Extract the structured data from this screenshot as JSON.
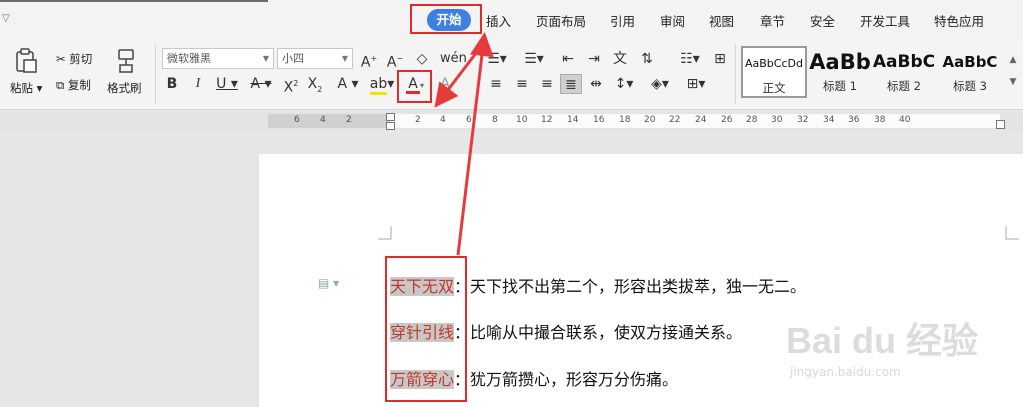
{
  "menu": {
    "tabs": [
      "插入",
      "页面布局",
      "引用",
      "审阅",
      "视图",
      "章节",
      "安全",
      "开发工具",
      "特色应用"
    ],
    "active_tab": "开始"
  },
  "ribbon": {
    "paste": "粘贴",
    "cut": "剪切",
    "copy": "复制",
    "format_painter": "格式刷",
    "font_name": "微软雅黑",
    "font_size": "小四",
    "styles": [
      {
        "sample": "AaBbCcDd",
        "name": "正文"
      },
      {
        "sample": "AaBb",
        "name": "标题 1"
      },
      {
        "sample": "AaBbC",
        "name": "标题 2"
      },
      {
        "sample": "AaBbC",
        "name": "标题 3"
      }
    ],
    "font_color": "#e02b2b"
  },
  "ruler": {
    "numbers": [
      "6",
      "4",
      "2",
      "2",
      "4",
      "6",
      "8",
      "10",
      "12",
      "14",
      "16",
      "18",
      "20",
      "22",
      "24",
      "26",
      "28",
      "30",
      "32",
      "34",
      "36",
      "38",
      "40"
    ]
  },
  "document": {
    "lines": [
      {
        "term": "天下无双",
        "rest": "：天下找不出第二个，形容出类拔萃，独一无二。"
      },
      {
        "term": "穿针引线",
        "rest": "：比喻从中撮合联系，使双方接通关系。"
      },
      {
        "term": "万箭穿心",
        "rest": "：犹万箭攒心，形容万分伤痛。"
      }
    ]
  },
  "watermark": {
    "logo": "Bai du 经验",
    "url": "jingyan.baidu.com"
  }
}
